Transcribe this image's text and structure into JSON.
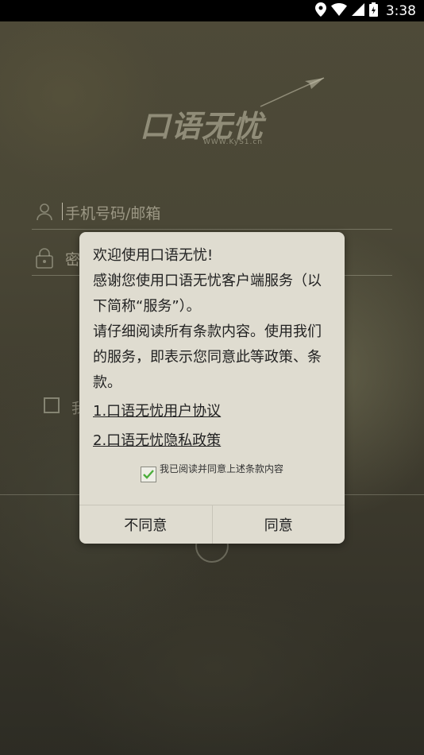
{
  "status_bar": {
    "time": "3:38"
  },
  "logo": {
    "brand": "口语无忧",
    "url": "WWW.KyS1.cn"
  },
  "login": {
    "account_placeholder": "手机号码/邮箱",
    "password_placeholder": "密",
    "remember_label": "我"
  },
  "dialog": {
    "welcome": "欢迎使用口语无忧!",
    "paragraph1": "感谢您使用口语无忧客户端服务（以下简称“服务”）。",
    "paragraph2": "请仔细阅读所有条款内容。使用我们的服务，即表示您同意此等政策、条款。",
    "link_user_agreement": "1.口语无忧用户协议",
    "link_privacy_policy": "2.口语无忧隐私政策",
    "agree_checkbox_label": "我已阅读并同意上述条款内容",
    "agree_checked": true,
    "disagree_button": "不同意",
    "agree_button": "同意"
  }
}
